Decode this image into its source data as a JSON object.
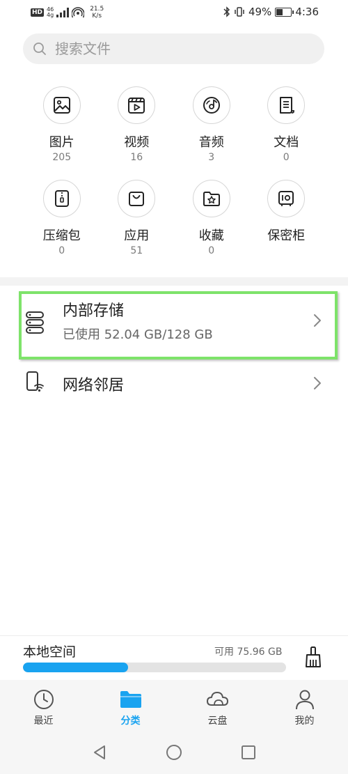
{
  "status_bar": {
    "hd": "HD",
    "net_top": "46",
    "net_bottom": "4g",
    "speed_value": "21.5",
    "speed_unit": "K/s",
    "battery_percent": "49%",
    "battery_level": 0.49,
    "time": "4:36"
  },
  "search": {
    "placeholder": "搜索文件"
  },
  "categories": [
    {
      "label": "图片",
      "count": "205",
      "icon": "image-icon"
    },
    {
      "label": "视频",
      "count": "16",
      "icon": "video-icon"
    },
    {
      "label": "音频",
      "count": "3",
      "icon": "audio-icon"
    },
    {
      "label": "文档",
      "count": "0",
      "icon": "document-icon"
    },
    {
      "label": "压缩包",
      "count": "0",
      "icon": "archive-icon"
    },
    {
      "label": "应用",
      "count": "51",
      "icon": "app-bag-icon"
    },
    {
      "label": "收藏",
      "count": "0",
      "icon": "favorite-folder-icon"
    },
    {
      "label": "保密柜",
      "count": "",
      "icon": "safe-icon"
    }
  ],
  "storage": {
    "internal_title": "内部存储",
    "internal_usage": "已使用 52.04 GB/128 GB",
    "network_title": "网络邻居"
  },
  "local_space": {
    "title": "本地空间",
    "free": "可用 75.96 GB",
    "used_fraction": 0.4
  },
  "tabs": [
    {
      "label": "最近",
      "icon": "clock-icon",
      "active": false
    },
    {
      "label": "分类",
      "icon": "folder-icon",
      "active": true
    },
    {
      "label": "云盘",
      "icon": "cloud-icon",
      "active": false
    },
    {
      "label": "我的",
      "icon": "person-icon",
      "active": false
    }
  ],
  "colors": {
    "accent": "#19a3f0",
    "highlight": "#7ee36a"
  }
}
